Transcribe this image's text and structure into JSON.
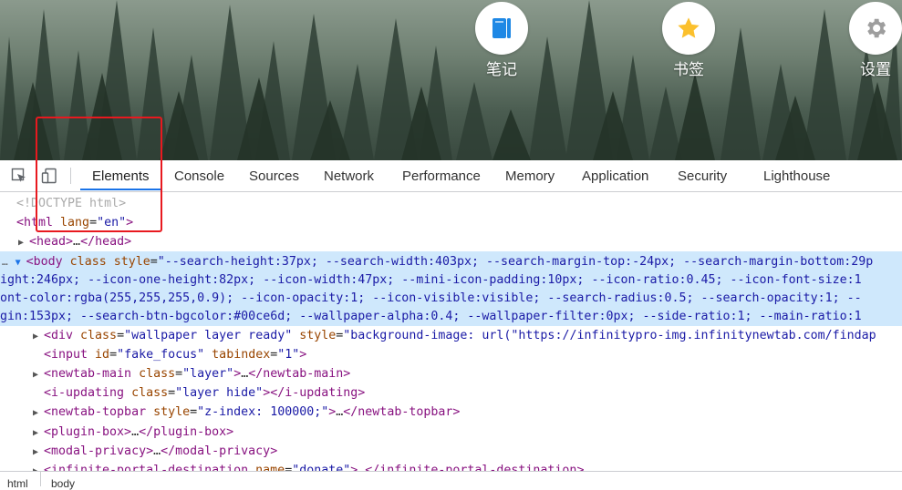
{
  "newtab": {
    "apps": [
      {
        "label": "笔记",
        "icon": "notes-icon",
        "color": "#1e88e5"
      },
      {
        "label": "书签",
        "icon": "star-icon",
        "color": "#fbc02d"
      },
      {
        "label": "设置",
        "icon": "gear-icon",
        "color": "#9e9e9e"
      }
    ]
  },
  "devtools": {
    "tabs": [
      "Elements",
      "Console",
      "Sources",
      "Network",
      "Performance",
      "Memory",
      "Application",
      "Security",
      "Lighthouse"
    ],
    "active_tab": "Elements",
    "accent_color": "#1a73e8",
    "tree": {
      "doctype": "<!DOCTYPE html>",
      "html_open": {
        "tag": "<html",
        "attr": " lang",
        "eq": "=",
        "val": "\"en\"",
        "close": ">"
      },
      "head": {
        "tag": "<head>",
        "ellipsis": "…",
        "close_tag": "</head>"
      },
      "body_line1": {
        "tag": "<body",
        "attr1": " class",
        "eq": "=",
        "val1": "\"",
        "attr2": "style",
        "val2": "\"--search-height:37px; --search-width:403px; --search-margin-top:-24px; --search-margin-bottom:29p"
      },
      "body_line2": "ight:246px; --icon-one-height:82px; --icon-width:47px; --mini-icon-padding:10px; --icon-ratio:0.45; --icon-font-size:1",
      "body_line3": "ont-color:rgba(255,255,255,0.9); --icon-opacity:1; --icon-visible:visible; --search-radius:0.5; --search-opacity:1; --",
      "body_line4": "gin:153px; --search-btn-bgcolor:#00ce6d; --wallpaper-alpha:0.4; --wallpaper-filter:0px; --side-ratio:1; --main-ratio:1",
      "div_line": {
        "tag": "<div",
        "attr1": " class",
        "val1": "\"wallpaper layer ready\"",
        "attr2": " style",
        "val2": "\"background-image: url(\"https://infinitypro-img.infinitynewtab.com/findap"
      },
      "input_line": {
        "tag": "<input",
        "attr1": " id",
        "val1": "\"fake_focus\"",
        "attr2": " tabindex",
        "val2": "\"1\"",
        "close": ">"
      },
      "newtab_main": {
        "tag": "<newtab-main",
        "attr": " class",
        "val": "\"layer\"",
        "close": ">",
        "ellipsis": "…",
        "end": "</newtab-main>"
      },
      "i_updating": {
        "tag": "<i-updating",
        "attr": " class",
        "val": "\"layer hide\"",
        "close": ">",
        "end": "</i-updating>"
      },
      "newtab_topbar": {
        "tag": "<newtab-topbar",
        "attr": " style",
        "val": "\"z-index: 100000;\"",
        "close": ">",
        "ellipsis": "…",
        "end": "</newtab-topbar>"
      },
      "plugin_box": {
        "tag": "<plugin-box>",
        "ellipsis": "…",
        "end": "</plugin-box>"
      },
      "modal_privacy": {
        "tag": "<modal-privacy>",
        "ellipsis": "…",
        "end": "</modal-privacy>"
      },
      "portal": {
        "tag": "<infinite-portal-destination",
        "attr": " name",
        "val": "\"donate\"",
        "close": ">",
        "ellipsis": "…",
        "end": "</infinite-portal-destination>"
      }
    },
    "breadcrumb": [
      "html",
      "body"
    ],
    "ellipsis_marker": "…"
  }
}
